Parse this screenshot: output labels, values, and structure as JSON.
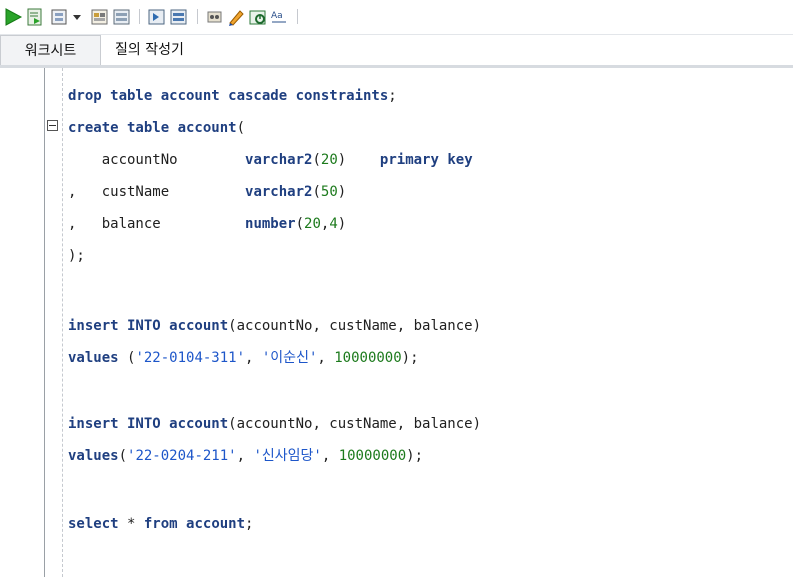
{
  "toolbar": {
    "buttons": [
      {
        "name": "run-statement-icon",
        "color": "#2aa32a"
      },
      {
        "name": "run-script-icon"
      },
      {
        "name": "autotrace-icon"
      },
      {
        "name": "dropdown-icon"
      },
      {
        "name": "commit-icon"
      },
      {
        "name": "rollback-icon"
      },
      {
        "name": "cancel-icon"
      },
      {
        "name": "sql-tuning-icon"
      },
      {
        "name": "clear-eraser-icon"
      },
      {
        "name": "history-icon"
      },
      {
        "name": "format-case-icon"
      }
    ]
  },
  "tabs": [
    {
      "label": "워크시트",
      "active": true
    },
    {
      "label": "질의 작성기",
      "active": false
    }
  ],
  "editor": {
    "lines": [
      {
        "tokens": [
          [
            "kw",
            "drop table account cascade constraints"
          ],
          [
            "punc",
            ";"
          ]
        ]
      },
      {
        "tokens": [
          [
            "kw",
            "create table account"
          ],
          [
            "punc",
            "(  "
          ]
        ]
      },
      {
        "tokens": [
          [
            "id",
            "    accountNo        "
          ],
          [
            "kw",
            "varchar2"
          ],
          [
            "punc",
            "("
          ],
          [
            "num",
            "20"
          ],
          [
            "punc",
            ")"
          ],
          [
            "id",
            "    "
          ],
          [
            "kw",
            "primary key"
          ]
        ]
      },
      {
        "tokens": [
          [
            "punc",
            ",   "
          ],
          [
            "id",
            "custName         "
          ],
          [
            "kw",
            "varchar2"
          ],
          [
            "punc",
            "("
          ],
          [
            "num",
            "50"
          ],
          [
            "punc",
            ")"
          ]
        ]
      },
      {
        "tokens": [
          [
            "punc",
            ",   "
          ],
          [
            "id",
            "balance          "
          ],
          [
            "kw",
            "number"
          ],
          [
            "punc",
            "("
          ],
          [
            "num",
            "20"
          ],
          [
            "punc",
            ","
          ],
          [
            "num",
            "4"
          ],
          [
            "punc",
            ")"
          ]
        ]
      },
      {
        "tokens": [
          [
            "punc",
            ");"
          ]
        ]
      },
      {
        "tokens": []
      },
      {
        "tokens": [
          [
            "kw",
            "insert INTO account"
          ],
          [
            "punc",
            "("
          ],
          [
            "id",
            "accountNo, custName, balance"
          ],
          [
            "punc",
            ")"
          ]
        ]
      },
      {
        "tokens": [
          [
            "kw",
            "values"
          ],
          [
            "punc",
            " ("
          ],
          [
            "str",
            "'22-0104-311'"
          ],
          [
            "punc",
            ", "
          ],
          [
            "str",
            "'이순신'"
          ],
          [
            "punc",
            ", "
          ],
          [
            "num",
            "10000000"
          ],
          [
            "punc",
            ");"
          ]
        ]
      },
      {
        "tokens": []
      },
      {
        "tokens": [
          [
            "kw",
            "insert INTO account"
          ],
          [
            "punc",
            "("
          ],
          [
            "id",
            "accountNo, custName, balance"
          ],
          [
            "punc",
            ")"
          ]
        ]
      },
      {
        "tokens": [
          [
            "kw",
            "values"
          ],
          [
            "punc",
            "("
          ],
          [
            "str",
            "'22-0204-211'"
          ],
          [
            "punc",
            ", "
          ],
          [
            "str",
            "'신사임당'"
          ],
          [
            "punc",
            ", "
          ],
          [
            "num",
            "10000000"
          ],
          [
            "punc",
            ");"
          ]
        ]
      },
      {
        "tokens": []
      },
      {
        "tokens": [
          [
            "kw",
            "select"
          ],
          [
            "punc",
            " * "
          ],
          [
            "kw",
            "from"
          ],
          [
            "punc",
            " "
          ],
          [
            "kw",
            "account"
          ],
          [
            "punc",
            ";"
          ]
        ]
      }
    ]
  }
}
